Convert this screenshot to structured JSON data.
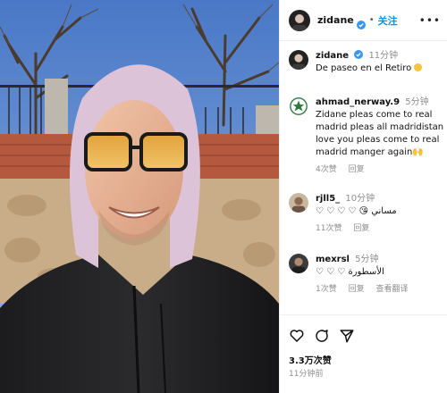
{
  "post": {
    "username": "zidane",
    "follow_label": "关注",
    "dot": "•",
    "more_icon": "more-horizontal-icon",
    "verified_color": "#3897f0",
    "accent_color": "#0095f6"
  },
  "caption": {
    "username": "zidane",
    "time": "11分钟",
    "text": "De paseo en el Retiro"
  },
  "comments": [
    {
      "username": "ahmad_nerway.9",
      "time": "5分钟",
      "text": "Zidane pleas come to real madrid pleas all madridistan love you pleas come to real madrid manger again🙌",
      "likes": "4次赞",
      "reply": "回复",
      "translate": ""
    },
    {
      "username": "rjll5_",
      "time": "10分钟",
      "text": "♡ ♡ ♡ ♡ 😘 مساني",
      "likes": "11次赞",
      "reply": "回复",
      "translate": ""
    },
    {
      "username": "mexrsl",
      "time": "5分钟",
      "text": "♡ ♡ ♡ الأسطورة",
      "likes": "1次赞",
      "reply": "回复",
      "translate": "查看翻译"
    }
  ],
  "footer": {
    "like_count": "3.3万次赞",
    "posted_ago": "11分钟前"
  }
}
